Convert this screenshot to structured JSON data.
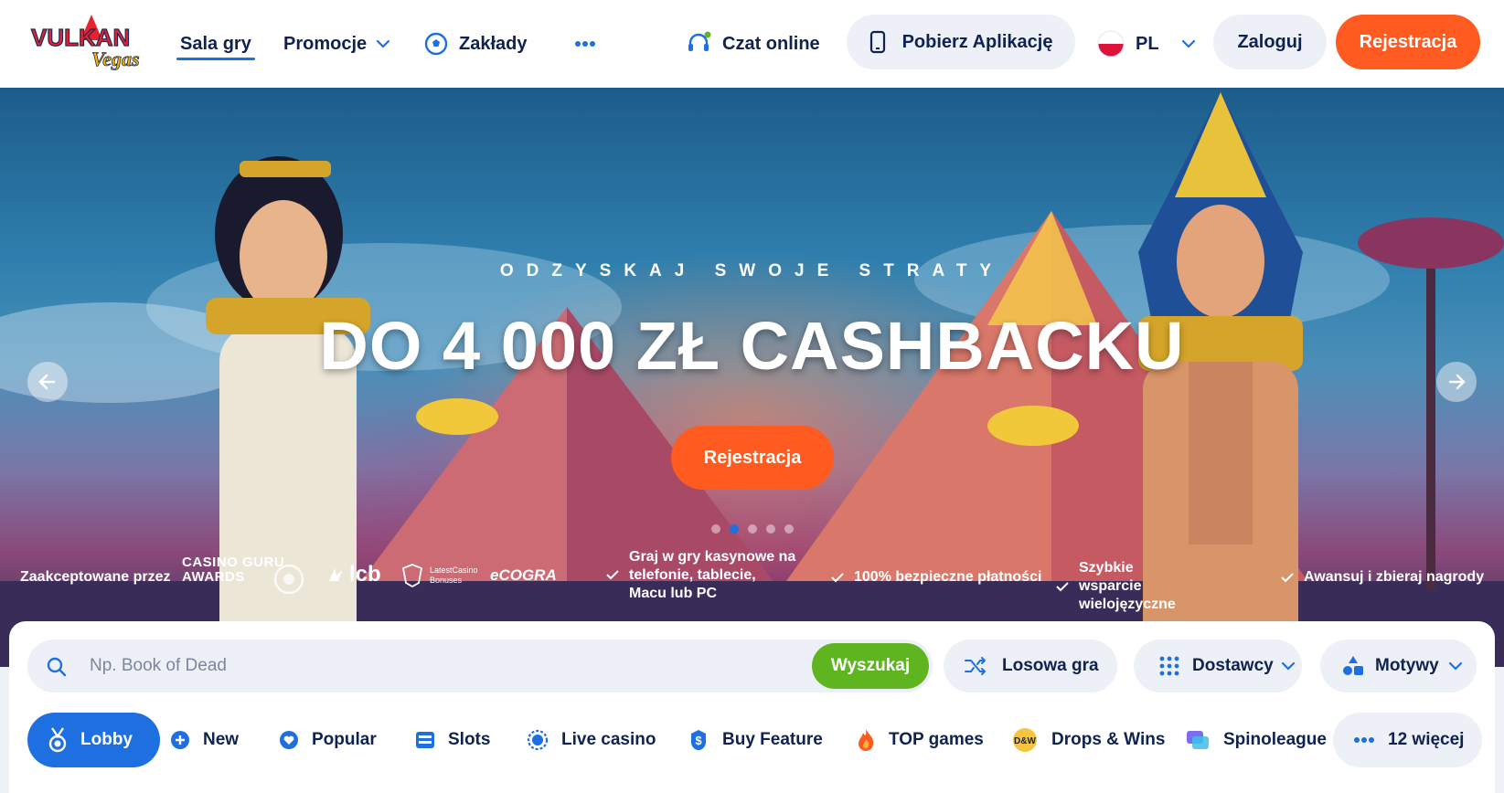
{
  "brand": {
    "logo_main": "VULKAN",
    "logo_sub": "Vegas",
    "accent": "#ff5a1f",
    "primary": "#1e6fe0",
    "success": "#5fb51f",
    "ink": "#0f2250"
  },
  "nav": {
    "items": [
      {
        "label": "Sala gry",
        "active": true
      },
      {
        "label": "Promocje",
        "icon": "chevron-down-icon"
      },
      {
        "label": "Zakłady",
        "icon": "soccer-ball-icon"
      },
      {
        "label": "",
        "icon": "more-dots-icon"
      }
    ],
    "chat_label": "Czat online",
    "app_label": "Pobierz Aplikację",
    "language": "PL",
    "login_label": "Zaloguj",
    "register_label": "Rejestracja"
  },
  "hero": {
    "eyebrow": "ODZYSKAJ SWOJE STRATY",
    "title": "DO 4 000 ZŁ CASHBACKU",
    "cta_label": "Rejestracja",
    "slides_total": 5,
    "active_slide": 2,
    "accepted_by_label": "Zaakceptowane przez",
    "awards": [
      "CASINO GURU",
      "AWARDS",
      "lcb",
      "LatestCasino",
      "Bonuses",
      "eCOGRA"
    ],
    "features": [
      "Graj w gry kasynowe na telefonie, tablecie, Macu lub PC",
      "100% bezpieczne płatności",
      "Szybkie wsparcie wielojęzyczne",
      "Awansuj i zbieraj nagrody"
    ]
  },
  "search": {
    "placeholder": "Np. Book of Dead",
    "value": "",
    "button_label": "Wyszukaj"
  },
  "filters": {
    "random_label": "Losowa gra",
    "providers_label": "Dostawcy",
    "themes_label": "Motywy"
  },
  "categories": [
    {
      "label": "Lobby",
      "icon": "medal-icon",
      "active": true
    },
    {
      "label": "New",
      "icon": "plus-circle-icon"
    },
    {
      "label": "Popular",
      "icon": "heart-icon"
    },
    {
      "label": "Slots",
      "icon": "slot-machine-icon"
    },
    {
      "label": "Live casino",
      "icon": "live-dot-icon"
    },
    {
      "label": "Buy Feature",
      "icon": "dollar-icon"
    },
    {
      "label": "TOP games",
      "icon": "flame-icon"
    },
    {
      "label": "Drops & Wins",
      "icon": "dw-badge-icon"
    },
    {
      "label": "Spinoleague",
      "icon": "spinoleague-icon"
    },
    {
      "label": "12 więcej",
      "icon": "more-dots-icon"
    }
  ]
}
